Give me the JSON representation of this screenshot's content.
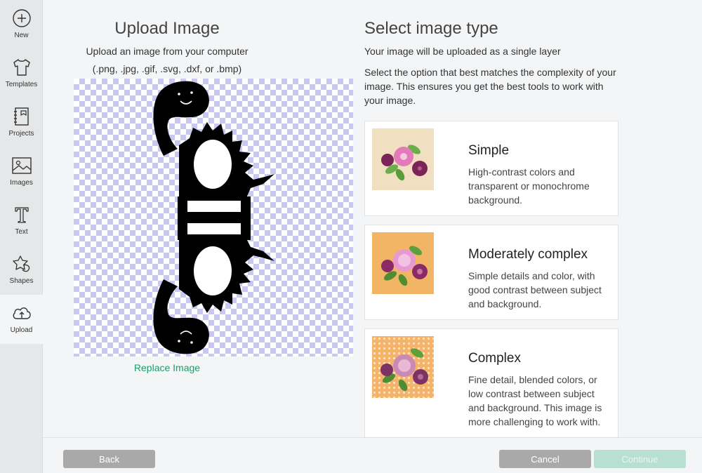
{
  "sidebar": {
    "items": [
      {
        "label": "New",
        "icon": "plus-circle-icon"
      },
      {
        "label": "Templates",
        "icon": "tshirt-icon"
      },
      {
        "label": "Projects",
        "icon": "notebook-icon"
      },
      {
        "label": "Images",
        "icon": "image-icon"
      },
      {
        "label": "Text",
        "icon": "text-icon"
      },
      {
        "label": "Shapes",
        "icon": "shapes-icon"
      },
      {
        "label": "Upload",
        "icon": "cloud-upload-icon",
        "active": true
      }
    ]
  },
  "upload": {
    "title": "Upload Image",
    "subtitle_line1": "Upload an image from your computer",
    "subtitle_line2": "(.png, .jpg, .gif, .svg, .dxf, or .bmp)",
    "replace_label": "Replace Image"
  },
  "select": {
    "title": "Select image type",
    "subtitle": "Your image will be uploaded as a single layer",
    "description": "Select the option that best matches the complexity of your image. This ensures you get the best tools to work with your image.",
    "options": [
      {
        "title": "Simple",
        "description": "High-contrast colors and transparent or monochrome background.",
        "thumb_bg": "#f0dfc0"
      },
      {
        "title": "Moderately complex",
        "description": "Simple details and color, with good contrast between subject and background.",
        "thumb_bg": "#f2b566"
      },
      {
        "title": "Complex",
        "description": "Fine detail, blended colors, or low contrast between subject and background. This image is more challenging to work with.",
        "thumb_bg": "#f5b36a"
      }
    ]
  },
  "footer": {
    "back_label": "Back",
    "cancel_label": "Cancel",
    "continue_label": "Continue"
  },
  "colors": {
    "accent_green": "#1a9e6a",
    "continue_disabled": "#b8e0d0",
    "button_gray": "#a9a9a9"
  }
}
